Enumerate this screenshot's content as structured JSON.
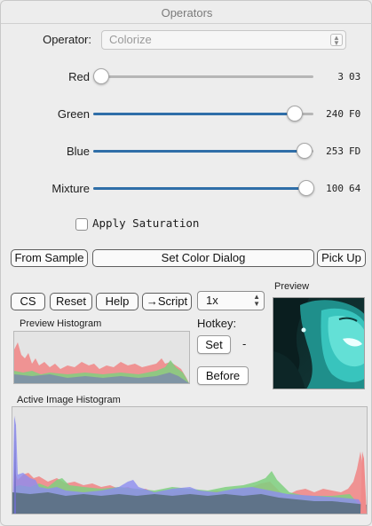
{
  "window": {
    "title": "Operators"
  },
  "operator": {
    "label": "Operator:",
    "selected": "Colorize"
  },
  "sliders": [
    {
      "label": "Red",
      "value": "3",
      "hex": "03",
      "fraction": 0.012
    },
    {
      "label": "Green",
      "value": "240",
      "hex": "F0",
      "fraction": 0.941
    },
    {
      "label": "Blue",
      "value": "253",
      "hex": "FD",
      "fraction": 0.992
    },
    {
      "label": "Mixture",
      "value": "100",
      "hex": "64",
      "fraction": 1.0
    }
  ],
  "apply_saturation": {
    "label": "Apply Saturation",
    "checked": false
  },
  "color_buttons": {
    "from_sample": "From Sample",
    "set_color_dialog": "Set Color Dialog",
    "pick_up": "Pick Up"
  },
  "action_buttons": {
    "cs": "CS",
    "reset": "Reset",
    "help": "Help",
    "script": "→Script"
  },
  "zoom": {
    "selected": "1x"
  },
  "preview": {
    "label": "Preview"
  },
  "hotkey": {
    "label": "Hotkey:",
    "set": "Set",
    "value": "-"
  },
  "before_button": "Before",
  "preview_histogram": {
    "label": "Preview Histogram"
  },
  "active_histogram": {
    "label": "Active Image Histogram"
  },
  "colors": {
    "slider_fill": "#2f6ea8",
    "hist_red": "#f08a8a",
    "hist_green": "#7fd07f",
    "hist_blue": "#8c8cf0",
    "hist_overlap": "#5a6f7f"
  }
}
